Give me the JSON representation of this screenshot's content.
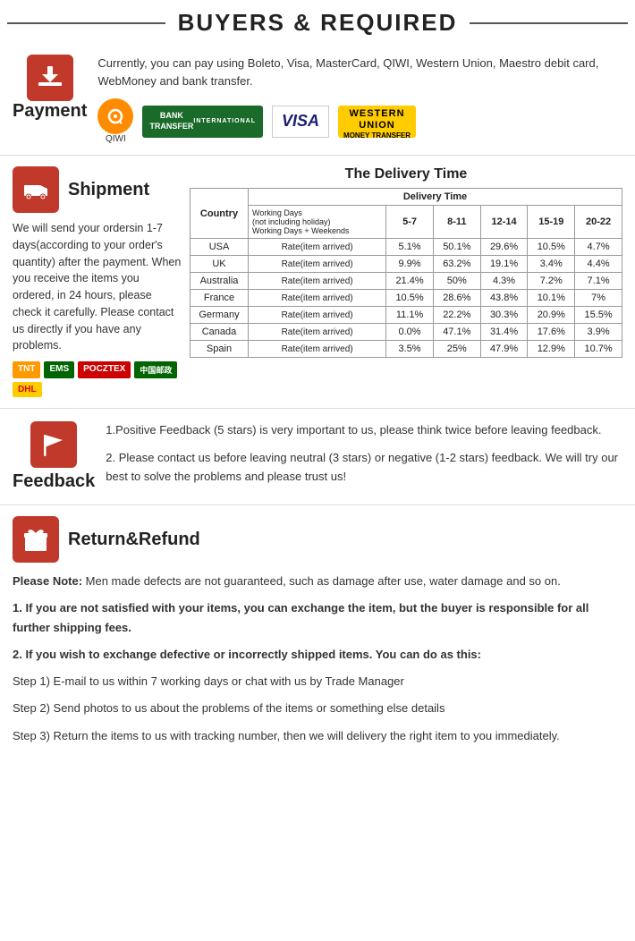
{
  "header": {
    "title": "BUYERS & REQUIRED"
  },
  "payment": {
    "section_title": "Payment",
    "description": "Currently, you can pay using Boleto, Visa, MasterCard, QIWI, Western Union, Maestro  debit card, WebMoney and bank transfer.",
    "logos": [
      {
        "name": "QIWI",
        "type": "qiwi"
      },
      {
        "name": "BANK TRANSFER INTERNATIONAL",
        "type": "bank"
      },
      {
        "name": "VISA",
        "type": "visa"
      },
      {
        "name": "WESTERN UNION MONEY TRANSFER",
        "type": "wu"
      }
    ]
  },
  "shipment": {
    "section_title": "Shipment",
    "delivery_title": "The Delivery Time",
    "description": "We will send your ordersin 1-7 days(according to your order's quantity) after the payment. When you receive the items you ordered, in 24  hours, please check it carefully. Please  contact us directly if you have any problems.",
    "carriers": [
      "TNT",
      "EMS",
      "POCZTEX",
      "CHINAPOST",
      "DHL"
    ],
    "table": {
      "col_headers": [
        "Country",
        "Delivery Time"
      ],
      "sub_headers": [
        "Working Days\n(not including holiday)\nWorking Days + Weekends",
        "5-7",
        "8-11",
        "12-14",
        "15-19",
        "20-22"
      ],
      "row_label": "Rate(item arrived)",
      "rows": [
        {
          "country": "USA",
          "c1": "5.1%",
          "c2": "50.1%",
          "c3": "29.6%",
          "c4": "10.5%",
          "c5": "4.7%"
        },
        {
          "country": "UK",
          "c1": "9.9%",
          "c2": "63.2%",
          "c3": "19.1%",
          "c4": "3.4%",
          "c5": "4.4%"
        },
        {
          "country": "Australia",
          "c1": "21.4%",
          "c2": "50%",
          "c3": "4.3%",
          "c4": "7.2%",
          "c5": "7.1%"
        },
        {
          "country": "France",
          "c1": "10.5%",
          "c2": "28.6%",
          "c3": "43.8%",
          "c4": "10.1%",
          "c5": "7%"
        },
        {
          "country": "Germany",
          "c1": "11.1%",
          "c2": "22.2%",
          "c3": "30.3%",
          "c4": "20.9%",
          "c5": "15.5%"
        },
        {
          "country": "Canada",
          "c1": "0.0%",
          "c2": "47.1%",
          "c3": "31.4%",
          "c4": "17.6%",
          "c5": "3.9%"
        },
        {
          "country": "Spain",
          "c1": "3.5%",
          "c2": "25%",
          "c3": "47.9%",
          "c4": "12.9%",
          "c5": "10.7%"
        }
      ]
    }
  },
  "feedback": {
    "section_title": "Feedback",
    "points": [
      "1.Positive Feedback (5 stars) is very important to us, please think twice before leaving feedback.",
      "2. Please contact us before leaving neutral (3 stars) or negative  (1-2 stars) feedback. We will try our best to solve the problems and please trust us!"
    ]
  },
  "return_refund": {
    "section_title": "Return&Refund",
    "note_bold": "Please Note:",
    "note_text": " Men made defects are not guaranteed, such as damage after use, water damage and so on.",
    "point1_bold": "1. If you are not satisfied with your items, you can exchange the item, but the buyer is responsible for all further shipping fees.",
    "point2_bold": "2. If you wish to exchange defective or incorrectly shipped items. You can do as this:",
    "steps": [
      " Step 1) E-mail to us within 7 working days or chat with us by Trade Manager",
      " Step 2) Send photos to us about the problems of the items or something else details",
      " Step 3) Return the items to us with tracking number, then we will delivery the right item to you immediately."
    ]
  }
}
